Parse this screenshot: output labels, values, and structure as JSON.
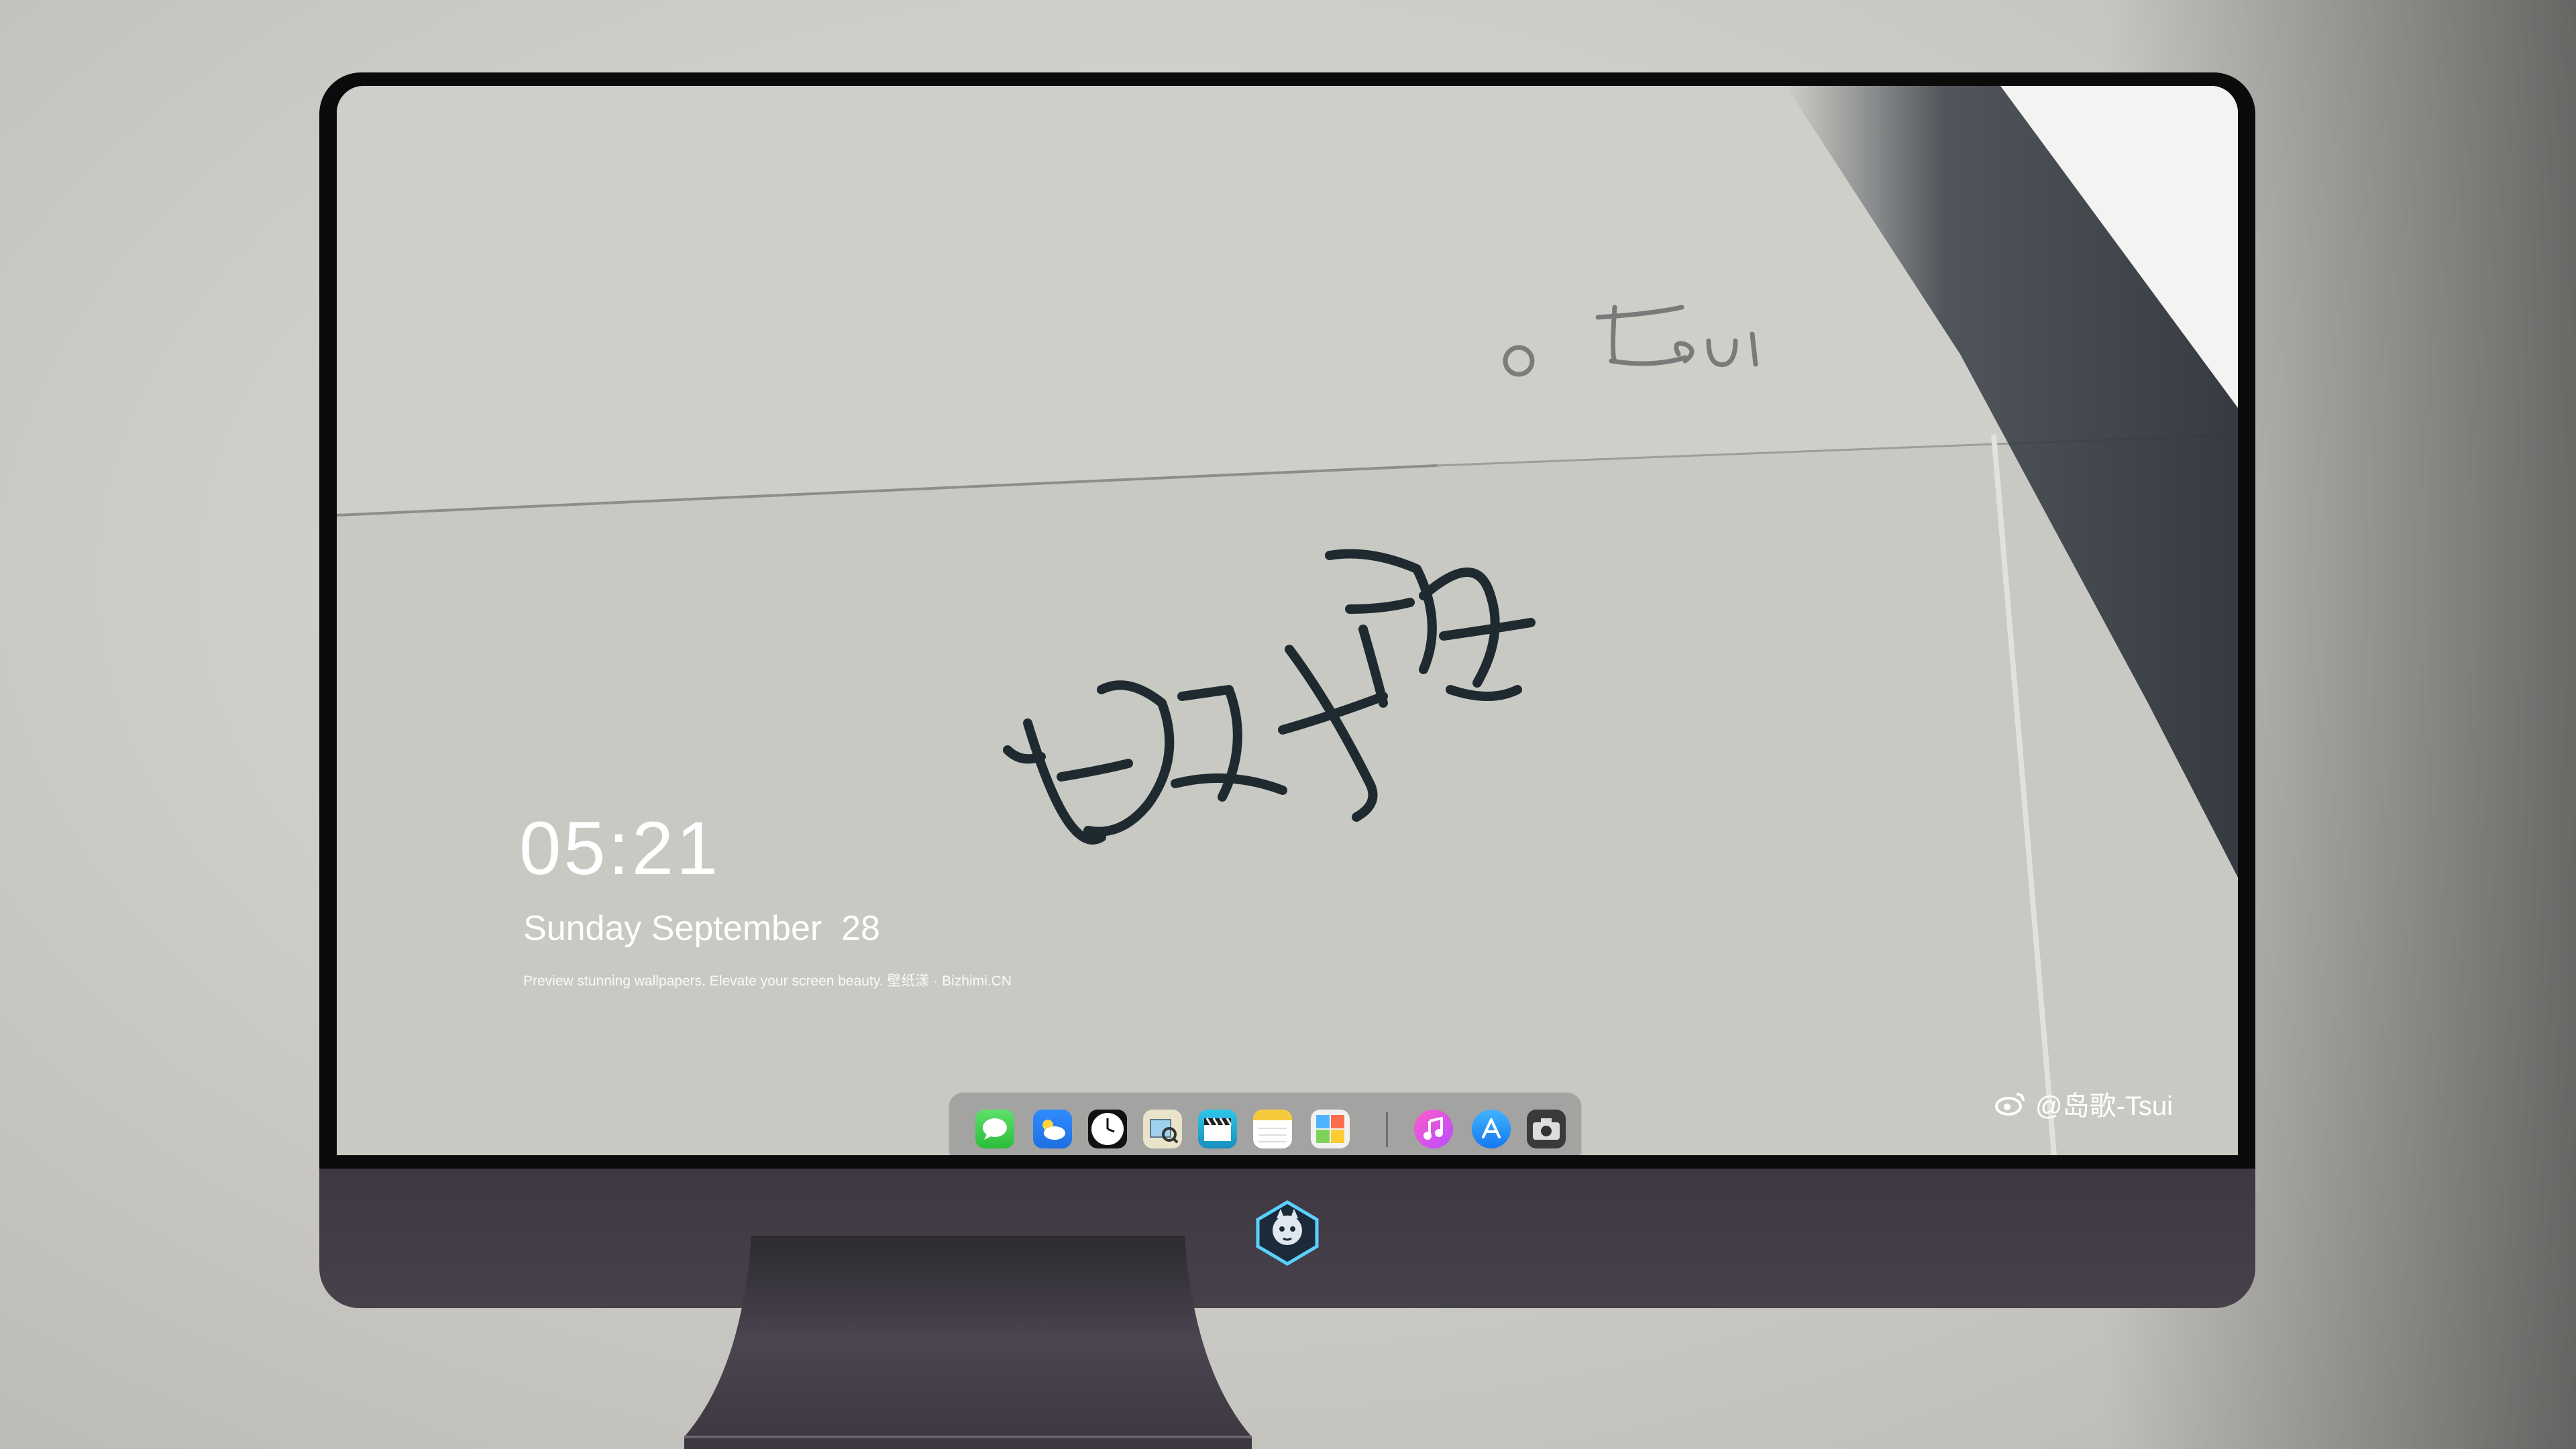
{
  "lock_screen": {
    "time": "05:21",
    "date": "Sunday September  28",
    "tagline": "Preview stunning wallpapers. Elevate your screen beauty. 壁纸漾 · Bizhimi.CN"
  },
  "wallpaper": {
    "handwriting_signature": "Tsui",
    "handwriting_chinese": "岁月静好"
  },
  "watermark": {
    "credit": "@岛歌-Tsui"
  },
  "dock": {
    "apps": [
      {
        "name": "Messages",
        "icon": "messages-icon"
      },
      {
        "name": "Weather",
        "icon": "weather-icon"
      },
      {
        "name": "Clock",
        "icon": "clock-icon"
      },
      {
        "name": "Preview",
        "icon": "preview-icon"
      },
      {
        "name": "Clips",
        "icon": "clapperboard-icon"
      },
      {
        "name": "Notes",
        "icon": "notes-icon"
      },
      {
        "name": "Photo Booth",
        "icon": "photo-booth-icon"
      },
      {
        "name": "iTunes",
        "icon": "music-icon"
      },
      {
        "name": "App Store",
        "icon": "app-store-icon"
      },
      {
        "name": "Camera",
        "icon": "camera-icon"
      }
    ]
  },
  "colors": {
    "bezel": "#0b0b0c",
    "chin": "#423c47",
    "dock_bg": "#969696",
    "text": "#ffffff"
  }
}
